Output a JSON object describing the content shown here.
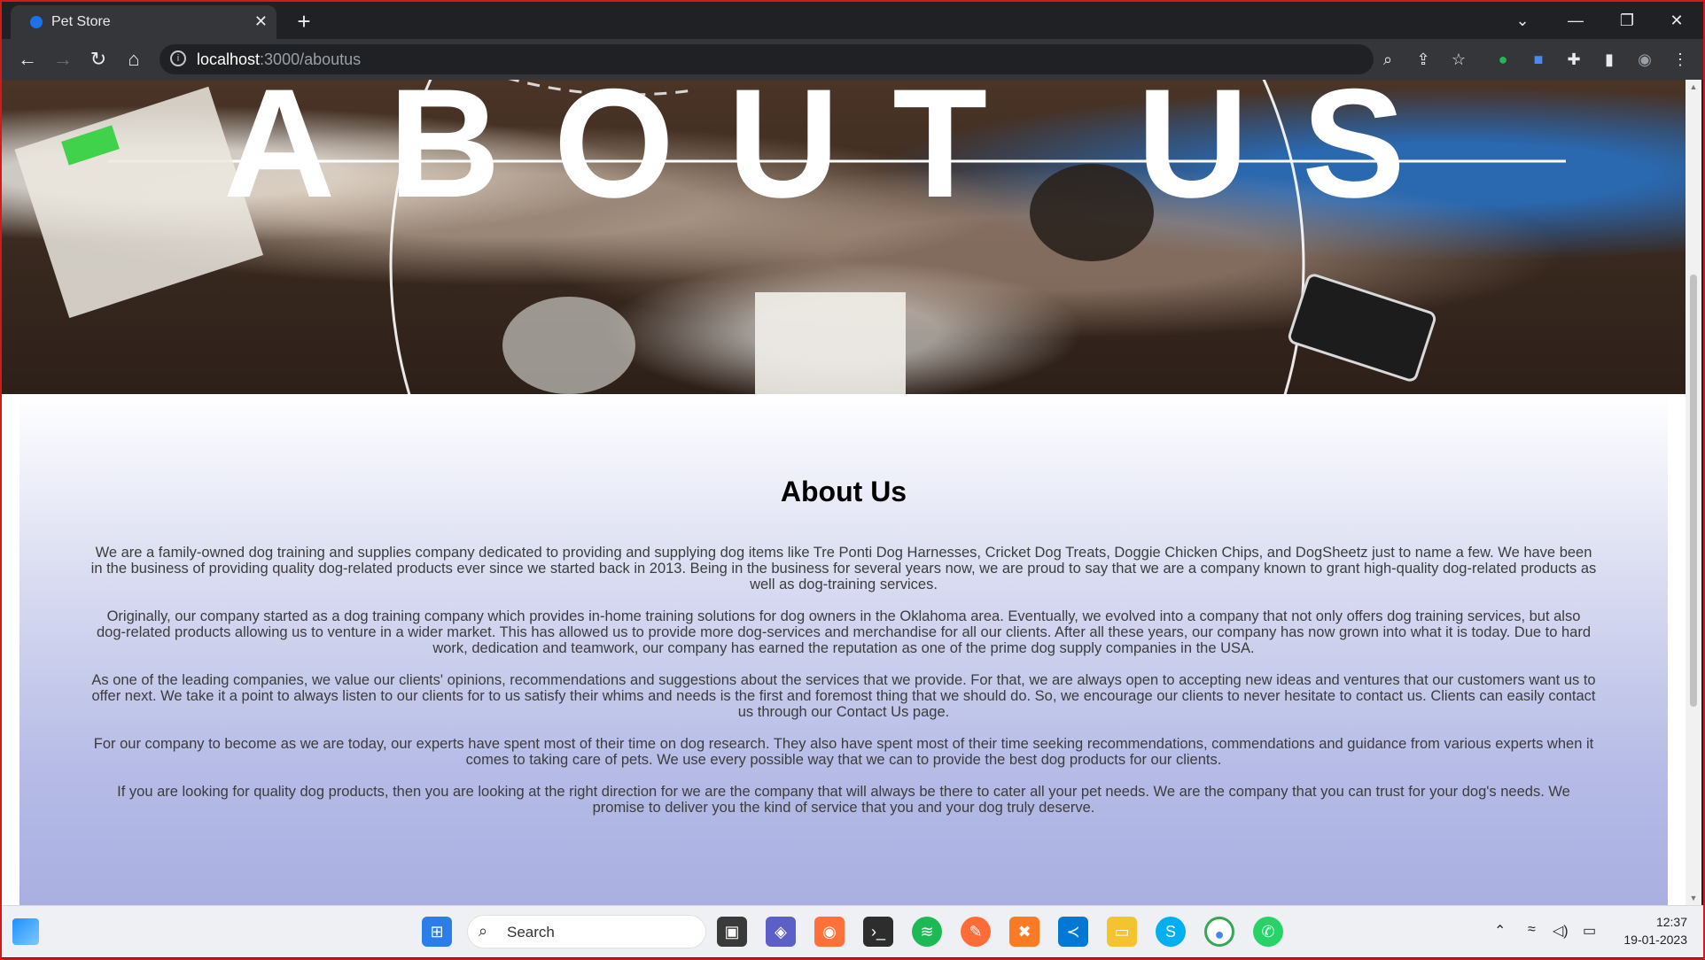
{
  "browser": {
    "tab_title": "Pet Store",
    "url_host": "localhost",
    "url_rest": ":3000/aboutus",
    "tab_close_glyph": "✕",
    "new_tab_glyph": "+",
    "window_controls": [
      "⌄",
      "—",
      "❐",
      "✕"
    ]
  },
  "hero": {
    "heading_text": "ABOUT US"
  },
  "content": {
    "title": "About Us",
    "paragraphs": [
      "We are a family-owned dog training and supplies company dedicated to providing and supplying dog items like Tre Ponti Dog Harnesses, Cricket Dog Treats, Doggie Chicken Chips, and DogSheetz just to name a few. We have been in the business of providing quality dog-related products ever since we started back in 2013. Being in the business for several years now, we are proud to say that we are a company known to grant high-quality dog-related products as well as dog-training services.",
      "Originally, our company started as a dog training company which provides in-home training solutions for dog owners in the Oklahoma area. Eventually, we evolved into a company that not only offers dog training services, but also dog-related products allowing us to venture in a wider market. This has allowed us to provide more dog-services and merchandise for all our clients. After all these years, our company has now grown into what it is today. Due to hard work, dedication and teamwork, our company has earned the reputation as one of the prime dog supply companies in the USA.",
      "As one of the leading companies, we value our clients' opinions, recommendations and suggestions about the services that we provide. For that, we are always open to accepting new ideas and ventures that our customers want us to offer next. We take it a point to always listen to our clients for to us satisfy their whims and needs is the first and foremost thing that we should do. So, we encourage our clients to never hesitate to contact us. Clients can easily contact us through our Contact Us page.",
      "For our company to become as we are today, our experts have spent most of their time on dog research. They also have spent most of their time seeking recommendations, commendations and guidance from various experts when it comes to taking care of pets. We use every possible way that we can to provide the best dog products for our clients.",
      "If you are looking for quality dog products, then you are looking at the right direction for we are the company that will always be there to cater all your pet needs. We are the company that you can trust for your dog's needs. We promise to deliver you the kind of service that you and your dog truly deserve."
    ]
  },
  "taskbar": {
    "search_placeholder": "Search",
    "time": "12:37",
    "date": "19-01-2023",
    "apps": [
      "start-icon",
      "task-view-icon",
      "teams-icon",
      "firefox-icon",
      "terminal-icon",
      "spotify-icon",
      "postman-icon",
      "xampp-icon",
      "vscode-icon",
      "file-explorer-icon",
      "skype-icon",
      "chrome-icon",
      "whatsapp-icon"
    ]
  },
  "colors": {
    "tab_active": "#35363a",
    "content_gradient_top": "#ffffff",
    "content_gradient_bottom": "#a7aee0"
  }
}
